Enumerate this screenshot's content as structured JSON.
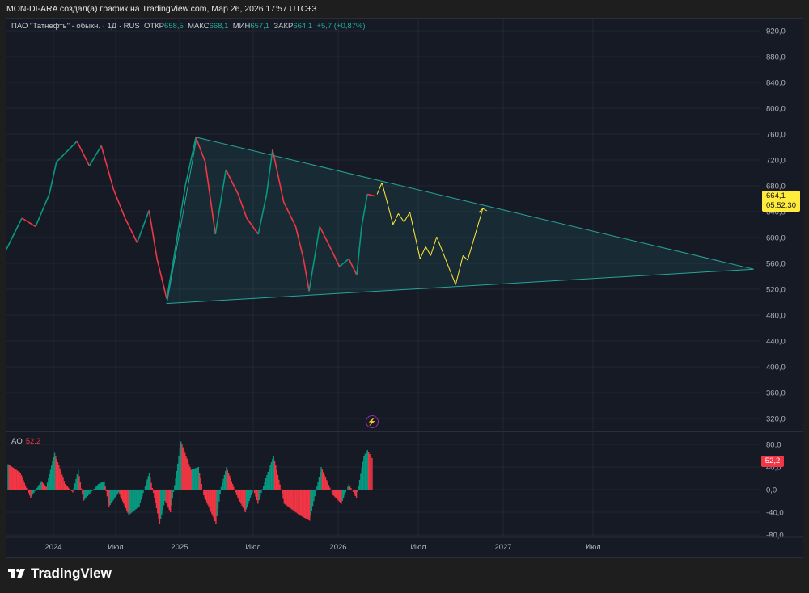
{
  "header": {
    "caption": "MON-DI-ARA создал(а) график на TradingView.com, Мар 26, 2026 17:57 UTC+3"
  },
  "legend": {
    "symbol": "ПАО \"Татнефть\" - обыкн. · 1Д · RUS",
    "open_label": "ОТКР",
    "open": "658,5",
    "high_label": "МАКС",
    "high": "668,1",
    "low_label": "МИН",
    "low": "657,1",
    "close_label": "ЗАКР",
    "close": "664,1",
    "change": "+5,7 (+0,87%)"
  },
  "price_tag": {
    "price": "664,1",
    "countdown": "05:52:30"
  },
  "ao_legend": {
    "name": "AO",
    "value": "52,2"
  },
  "ao_tag": "52,2",
  "footer": {
    "brand": "TradingView"
  },
  "colors": {
    "background": "#161a25",
    "up": "#089981",
    "down": "#f23645",
    "triangle": "#26a69a",
    "projection": "#ffeb3b",
    "price_tag": "#ffeb3b"
  },
  "chart_data": [
    {
      "type": "line",
      "pane": "price",
      "price_ticks": [
        "320,0",
        "360,0",
        "400,0",
        "440,0",
        "480,0",
        "520,0",
        "560,0",
        "600,0",
        "640,0",
        "680,0",
        "720,0",
        "760,0",
        "800,0",
        "840,0",
        "880,0",
        "920,0"
      ],
      "ylim": [
        320,
        920
      ],
      "grid": true,
      "x_ticks": [
        {
          "label": "2024",
          "date": "2024-01-01"
        },
        {
          "label": "Июл",
          "date": "2024-07-01"
        },
        {
          "label": "2025",
          "date": "2025-01-01"
        },
        {
          "label": "Июл",
          "date": "2025-07-01"
        },
        {
          "label": "2026",
          "date": "2026-01-01"
        },
        {
          "label": "Июл",
          "date": "2026-07-01"
        },
        {
          "label": "2027",
          "date": "2027-01-01"
        },
        {
          "label": "Июл",
          "date": "2027-07-01"
        }
      ],
      "price": [
        [
          "2023-08-15",
          580
        ],
        [
          "2023-10-01",
          630
        ],
        [
          "2023-11-10",
          617
        ],
        [
          "2023-12-20",
          667
        ],
        [
          "2024-01-10",
          717
        ],
        [
          "2024-03-10",
          749
        ],
        [
          "2024-04-15",
          711
        ],
        [
          "2024-05-20",
          742
        ],
        [
          "2024-06-25",
          674
        ],
        [
          "2024-07-28",
          630
        ],
        [
          "2024-09-01",
          592
        ],
        [
          "2024-10-05",
          642
        ],
        [
          "2024-10-28",
          567
        ],
        [
          "2024-11-25",
          505
        ],
        [
          "2024-12-15",
          567
        ],
        [
          "2025-01-15",
          680
        ],
        [
          "2025-02-10",
          755
        ],
        [
          "2025-03-05",
          717
        ],
        [
          "2025-03-30",
          605
        ],
        [
          "2025-04-25",
          705
        ],
        [
          "2025-05-25",
          667
        ],
        [
          "2025-06-15",
          630
        ],
        [
          "2025-07-12",
          605
        ],
        [
          "2025-07-30",
          667
        ],
        [
          "2025-08-12",
          736
        ],
        [
          "2025-09-05",
          655
        ],
        [
          "2025-10-01",
          617
        ],
        [
          "2025-10-18",
          567
        ],
        [
          "2025-10-30",
          517
        ],
        [
          "2025-11-22",
          617
        ],
        [
          "2025-12-18",
          580
        ],
        [
          "2026-01-04",
          555
        ],
        [
          "2026-01-25",
          567
        ],
        [
          "2026-02-12",
          542
        ],
        [
          "2026-02-23",
          617
        ],
        [
          "2026-03-08",
          667
        ],
        [
          "2026-03-26",
          664.1
        ]
      ],
      "triangle": [
        [
          "2025-02-12",
          755
        ],
        [
          "2024-11-25",
          498
        ],
        [
          "2028-05-20",
          551
        ]
      ],
      "projection": [
        [
          "2026-03-30",
          667
        ],
        [
          "2026-04-10",
          685
        ],
        [
          "2026-05-05",
          620
        ],
        [
          "2026-05-17",
          637
        ],
        [
          "2026-05-30",
          624
        ],
        [
          "2026-06-12",
          639
        ],
        [
          "2026-07-05",
          567
        ],
        [
          "2026-07-17",
          586
        ],
        [
          "2026-07-28",
          572
        ],
        [
          "2026-08-10",
          601
        ],
        [
          "2026-09-20",
          527
        ],
        [
          "2026-10-06",
          572
        ],
        [
          "2026-10-16",
          565
        ],
        [
          "2026-11-18",
          645
        ]
      ]
    },
    {
      "type": "bar",
      "pane": "AO",
      "title": "AO",
      "ylim": [
        -80,
        80
      ],
      "y_ticks": [
        "80,0",
        "40,0",
        "0,0",
        "-40,0",
        "-80,0"
      ],
      "values": [
        [
          "2023-08-20",
          45
        ],
        [
          "2023-09-25",
          30
        ],
        [
          "2023-10-25",
          -15
        ],
        [
          "2023-11-25",
          15
        ],
        [
          "2023-12-10",
          5
        ],
        [
          "2024-01-03",
          65
        ],
        [
          "2024-02-03",
          10
        ],
        [
          "2024-02-25",
          -5
        ],
        [
          "2024-03-12",
          35
        ],
        [
          "2024-03-27",
          -20
        ],
        [
          "2024-05-10",
          10
        ],
        [
          "2024-05-27",
          15
        ],
        [
          "2024-06-10",
          -30
        ],
        [
          "2024-07-08",
          -5
        ],
        [
          "2024-08-06",
          -45
        ],
        [
          "2024-09-05",
          -30
        ],
        [
          "2024-10-04",
          30
        ],
        [
          "2024-11-03",
          -60
        ],
        [
          "2024-11-18",
          -20
        ],
        [
          "2024-12-04",
          -40
        ],
        [
          "2024-12-19",
          20
        ],
        [
          "2025-01-03",
          85
        ],
        [
          "2025-01-28",
          35
        ],
        [
          "2025-02-15",
          40
        ],
        [
          "2025-02-28",
          -10
        ],
        [
          "2025-03-30",
          -60
        ],
        [
          "2025-04-12",
          5
        ],
        [
          "2025-04-25",
          40
        ],
        [
          "2025-05-20",
          -10
        ],
        [
          "2025-06-10",
          -40
        ],
        [
          "2025-06-30",
          0
        ],
        [
          "2025-07-10",
          -25
        ],
        [
          "2025-07-27",
          20
        ],
        [
          "2025-08-13",
          60
        ],
        [
          "2025-09-05",
          -25
        ],
        [
          "2025-10-08",
          -45
        ],
        [
          "2025-10-30",
          -55
        ],
        [
          "2025-11-24",
          40
        ],
        [
          "2025-12-20",
          -10
        ],
        [
          "2026-01-07",
          -25
        ],
        [
          "2026-01-24",
          10
        ],
        [
          "2026-02-10",
          -15
        ],
        [
          "2026-02-27",
          60
        ],
        [
          "2026-03-07",
          70
        ],
        [
          "2026-03-20",
          52.2
        ]
      ]
    }
  ]
}
